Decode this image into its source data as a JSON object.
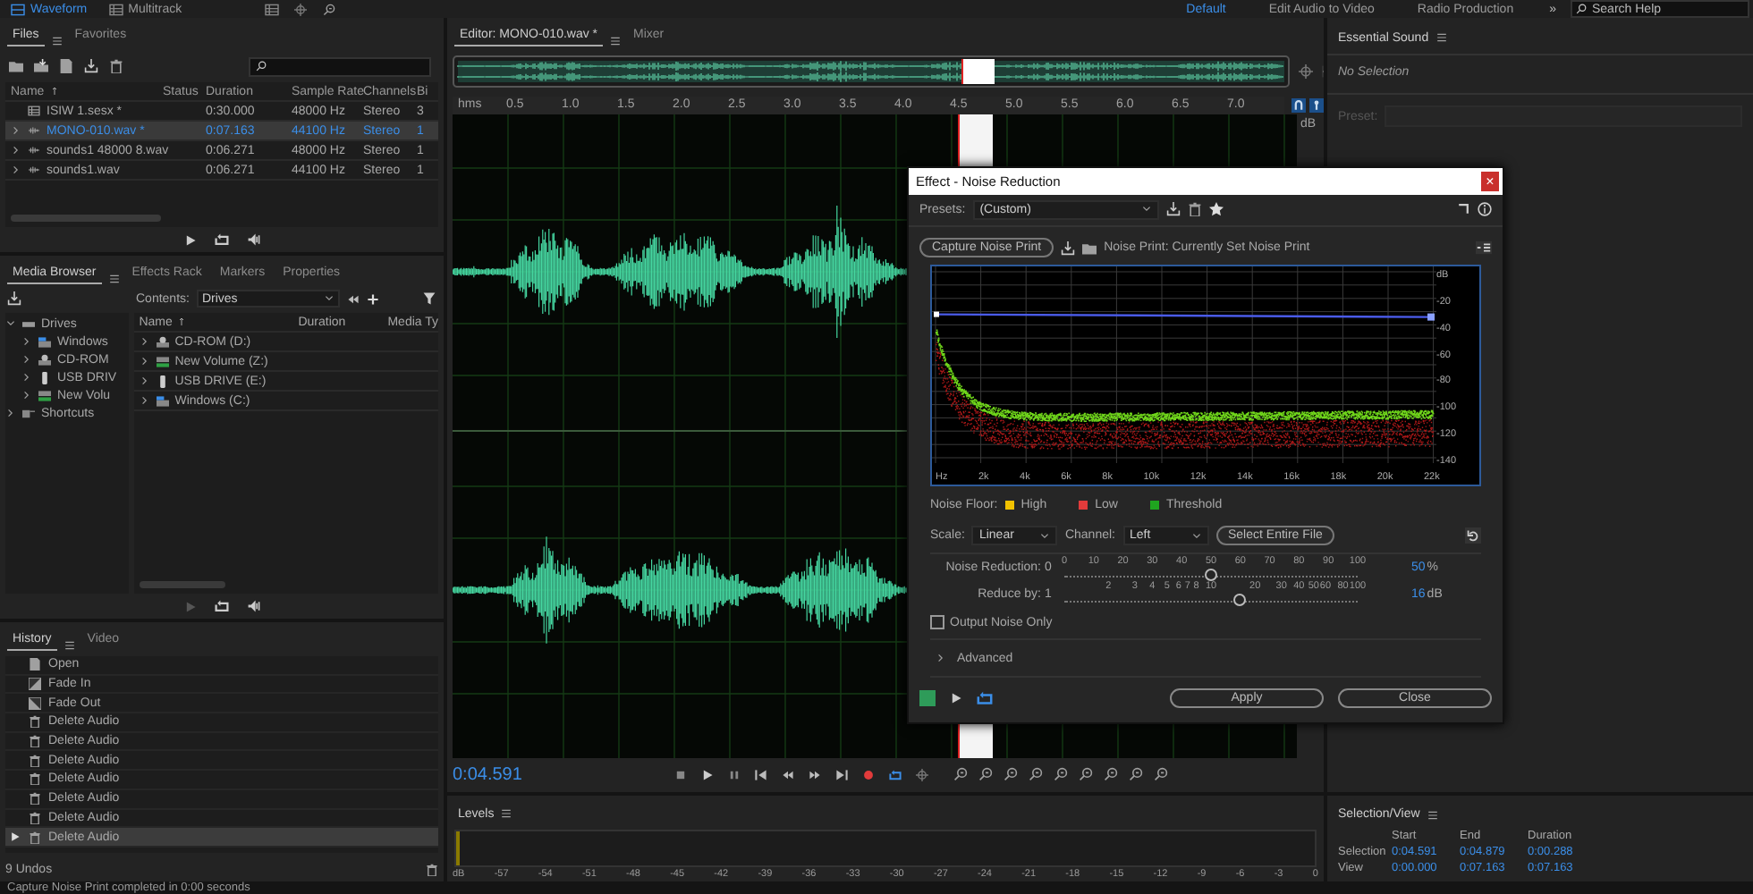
{
  "top_bar": {
    "mode_tabs": [
      {
        "label": "Waveform",
        "selected": true
      },
      {
        "label": "Multitrack",
        "selected": false
      }
    ],
    "workspaces": [
      {
        "label": "Default",
        "selected": true
      },
      {
        "label": "Edit Audio to Video",
        "selected": false
      },
      {
        "label": "Radio Production",
        "selected": false
      }
    ],
    "overflow": "»",
    "search": {
      "placeholder": "Search Help"
    }
  },
  "files_panel": {
    "tabs": [
      {
        "label": "Files",
        "selected": true
      },
      {
        "label": "Favorites",
        "selected": false
      }
    ],
    "columns": [
      "Name",
      "Status",
      "Duration",
      "Sample Rate",
      "Channels",
      "Bi"
    ],
    "rows": [
      {
        "kind": "session",
        "name": "ISIW 1.sesx *",
        "duration": "0:30.000",
        "sample_rate": "48000 Hz",
        "channels": "Stereo",
        "column_6": "3",
        "selected": false
      },
      {
        "kind": "audio",
        "name": "MONO-010.wav *",
        "duration": "0:07.163",
        "sample_rate": "44100 Hz",
        "channels": "Stereo",
        "column_6": "1",
        "selected": true
      },
      {
        "kind": "audio",
        "name": "sounds1 48000 8.wav",
        "duration": "0:06.271",
        "sample_rate": "48000 Hz",
        "channels": "Stereo",
        "column_6": "1",
        "selected": false
      },
      {
        "kind": "audio",
        "name": "sounds1.wav",
        "duration": "0:06.271",
        "sample_rate": "44100 Hz",
        "channels": "Stereo",
        "column_6": "1",
        "selected": false
      }
    ]
  },
  "media_browser": {
    "tabs": [
      {
        "label": "Media Browser",
        "selected": true
      },
      {
        "label": "Effects Rack",
        "selected": false
      },
      {
        "label": "Markers",
        "selected": false
      },
      {
        "label": "Properties",
        "selected": false
      }
    ],
    "contents_label": "Contents:",
    "contents": "Drives",
    "tree": [
      {
        "label": "Drives",
        "kind": "drives",
        "expanded": true,
        "children": [
          {
            "label": "Windows",
            "kind": "hdd",
            "expanded": false
          },
          {
            "label": "CD-ROM",
            "kind": "cdrom",
            "expanded": false
          },
          {
            "label": "USB DRIV",
            "kind": "usb",
            "expanded": false
          },
          {
            "label": "New Volu",
            "kind": "network",
            "expanded": false
          }
        ]
      },
      {
        "label": "Shortcuts",
        "kind": "shortcuts",
        "expanded": false
      }
    ],
    "columns": [
      "Name",
      "Duration",
      "Media Ty"
    ],
    "rows": [
      {
        "label": "CD-ROM (D:)",
        "kind": "cdrom",
        "expanded": false
      },
      {
        "label": "New Volume (Z:)",
        "kind": "network",
        "expanded": false
      },
      {
        "label": "USB DRIVE (E:)",
        "kind": "usb",
        "expanded": false
      },
      {
        "label": "Windows (C:)",
        "kind": "hdd",
        "expanded": false
      }
    ]
  },
  "history": {
    "tabs": [
      {
        "label": "History",
        "selected": true
      },
      {
        "label": "Video",
        "selected": false
      }
    ],
    "items": [
      {
        "label": "Open",
        "kind": "open",
        "selected": false
      },
      {
        "label": "Fade In",
        "kind": "fade-in",
        "selected": false
      },
      {
        "label": "Fade Out",
        "kind": "fade-out",
        "selected": false
      },
      {
        "label": "Delete Audio",
        "kind": "delete",
        "selected": false
      },
      {
        "label": "Delete Audio",
        "kind": "delete",
        "selected": false
      },
      {
        "label": "Delete Audio",
        "kind": "delete",
        "selected": false
      },
      {
        "label": "Delete Audio",
        "kind": "delete",
        "selected": false
      },
      {
        "label": "Delete Audio",
        "kind": "delete",
        "selected": false
      },
      {
        "label": "Delete Audio",
        "kind": "delete",
        "selected": false
      },
      {
        "label": "Delete Audio",
        "kind": "delete",
        "selected": true
      }
    ],
    "undo_count": "9 Undos"
  },
  "editor": {
    "tabs": [
      {
        "label": "Editor: MONO-010.wav *",
        "selected": true
      },
      {
        "label": "Mixer",
        "selected": false
      }
    ],
    "ruler_unit": "hms",
    "ruler_labels": [
      "0.5",
      "1.0",
      "1.5",
      "2.0",
      "2.5",
      "3.0",
      "3.5",
      "4.0",
      "4.5",
      "5.0",
      "5.5",
      "6.0",
      "6.5",
      "7.0"
    ],
    "db_label": "dB",
    "current_time": "0:04.591"
  },
  "essential_sound": {
    "title": "Essential Sound",
    "status": "No Selection",
    "preset_label": "Preset:"
  },
  "levels": {
    "title": "Levels",
    "scale": [
      "dB",
      "-57",
      "-54",
      "-51",
      "-48",
      "-45",
      "-42",
      "-39",
      "-36",
      "-33",
      "-30",
      "-27",
      "-24",
      "-21",
      "-18",
      "-15",
      "-12",
      "-9",
      "-6",
      "-3",
      "0"
    ]
  },
  "selection_view": {
    "title": "Selection/View",
    "columns": [
      "Start",
      "End",
      "Duration"
    ],
    "rows": [
      {
        "label": "Selection",
        "start": "0:04.591",
        "end": "0:04.879",
        "duration": "0:00.288"
      },
      {
        "label": "View",
        "start": "0:00.000",
        "end": "0:07.163",
        "duration": "0:07.163"
      }
    ]
  },
  "status_bar": {
    "message": "Capture Noise Print completed in 0:00 seconds"
  },
  "dialog": {
    "title": "Effect - Noise Reduction",
    "close": "×",
    "presets_label": "Presets:",
    "preset": "(Custom)",
    "capture_button": "Capture Noise Print",
    "noise_print": "Noise Print: Currently Set Noise Print",
    "graph": {
      "x_labels": [
        "Hz",
        "2k",
        "4k",
        "6k",
        "8k",
        "10k",
        "12k",
        "14k",
        "16k",
        "18k",
        "20k",
        "22k"
      ],
      "y_labels": [
        "dB",
        "-20",
        "-40",
        "-60",
        "-80",
        "-100",
        "-120",
        "-140"
      ]
    },
    "legend_label": "Noise Floor:",
    "legend": [
      {
        "label": "High",
        "color": "#f2c200"
      },
      {
        "label": "Low",
        "color": "#e23b3b"
      },
      {
        "label": "Threshold",
        "color": "#1fa51f"
      }
    ],
    "scale_label": "Scale:",
    "scale": "Linear",
    "channel_label": "Channel:",
    "channel": "Left",
    "select_button": "Select Entire File",
    "sliders": [
      {
        "kind": "linear",
        "label": "Noise Reduction:",
        "min_label": "0",
        "ticks": [
          "0",
          "10",
          "20",
          "30",
          "40",
          "50",
          "60",
          "70",
          "80",
          "90",
          "100"
        ],
        "level": 0.5,
        "value": "50",
        "unit": "%"
      },
      {
        "kind": "log",
        "label": "Reduce by:",
        "min_label": "1",
        "ticks": [
          "2",
          "3",
          "4",
          "5",
          "6",
          "7",
          "8",
          "10",
          "20",
          "30",
          "40",
          "50",
          "60",
          "80",
          "100"
        ],
        "level": 0.6,
        "value": "16",
        "unit": "dB"
      }
    ],
    "output_noise_only": {
      "label": "Output Noise Only",
      "checked": false
    },
    "advanced": {
      "label": "Advanced",
      "expanded": false
    },
    "power": {
      "on": true
    },
    "loop": {
      "on": true
    },
    "buttons": [
      "Apply",
      "Close"
    ]
  }
}
